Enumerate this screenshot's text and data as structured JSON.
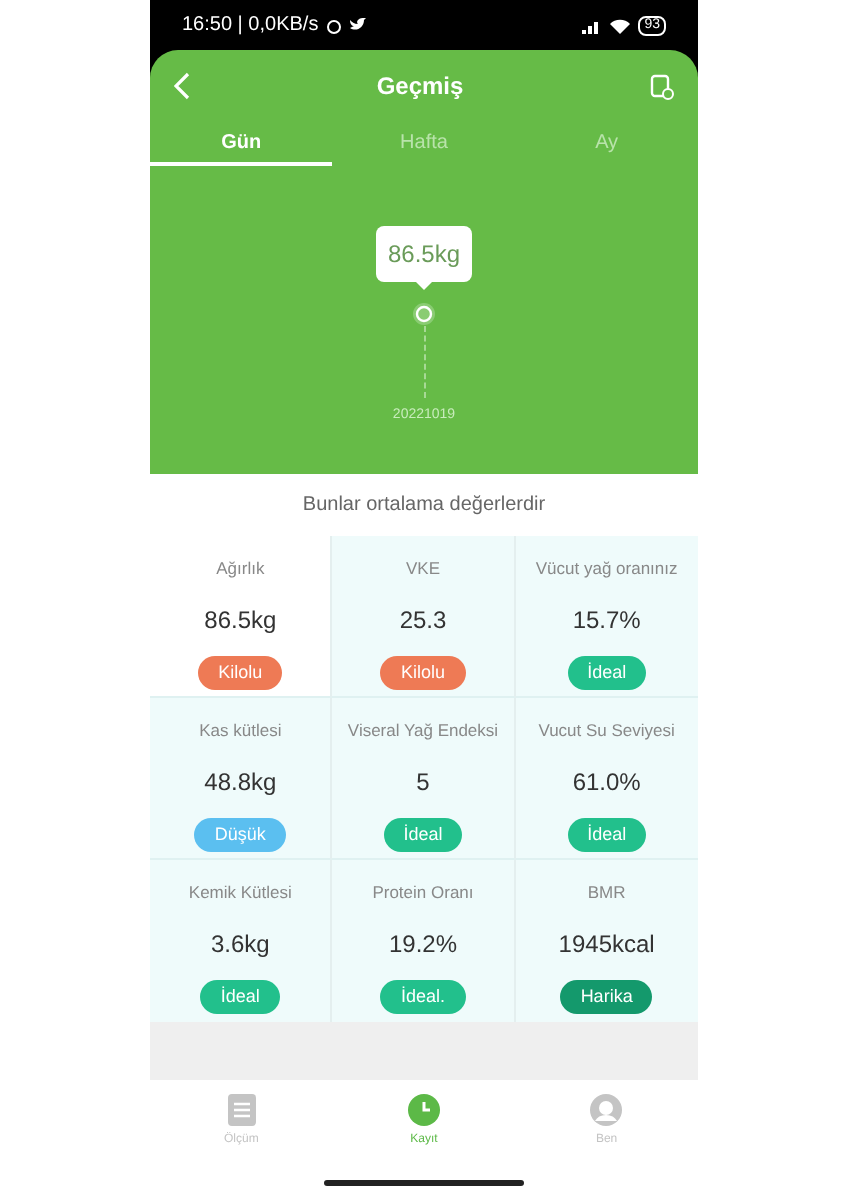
{
  "status_bar": {
    "time": "16:50 | 0,0KB/s",
    "battery": "93"
  },
  "header": {
    "title": "Geçmiş"
  },
  "tabs": [
    {
      "label": "Gün",
      "selected": true
    },
    {
      "label": "Hafta",
      "selected": false
    },
    {
      "label": "Ay",
      "selected": false
    }
  ],
  "chart": {
    "tooltip": "86.5kg",
    "date": "20221019"
  },
  "summary_note": "Bunlar ortalama değerlerdir",
  "metrics": [
    {
      "label": "Ağırlık",
      "value": "86.5kg",
      "badge": "Kilolu",
      "color": "#ee7a55",
      "highlighted": false
    },
    {
      "label": "VKE",
      "value": "25.3",
      "badge": "Kilolu",
      "color": "#ee7a55",
      "highlighted": true
    },
    {
      "label": "Vücut yağ oranınız",
      "value": "15.7%",
      "badge": "İdeal",
      "color": "#22c08c",
      "highlighted": true
    },
    {
      "label": "Kas kütlesi",
      "value": "48.8kg",
      "badge": "Düşük",
      "color": "#5bbff0",
      "highlighted": true
    },
    {
      "label": "Viseral Yağ Endeksi",
      "value": "5",
      "badge": "İdeal",
      "color": "#22c08c",
      "highlighted": true
    },
    {
      "label": "Vucut Su Seviyesi",
      "value": "61.0%",
      "badge": "İdeal",
      "color": "#22c08c",
      "highlighted": true
    },
    {
      "label": "Kemik Kütlesi",
      "value": "3.6kg",
      "badge": "İdeal",
      "color": "#22c08c",
      "highlighted": true
    },
    {
      "label": "Protein Oranı",
      "value": "19.2%",
      "badge": "İdeal.",
      "color": "#22c08c",
      "highlighted": true
    },
    {
      "label": "BMR",
      "value": "1945kcal",
      "badge": "Harika",
      "color": "#14996c",
      "highlighted": true
    }
  ],
  "bottom_nav": [
    {
      "label": "Ölçüm",
      "kind": "list",
      "selected": false
    },
    {
      "label": "Kayıt",
      "kind": "clock",
      "selected": true
    },
    {
      "label": "Ben",
      "kind": "person",
      "selected": false
    }
  ]
}
